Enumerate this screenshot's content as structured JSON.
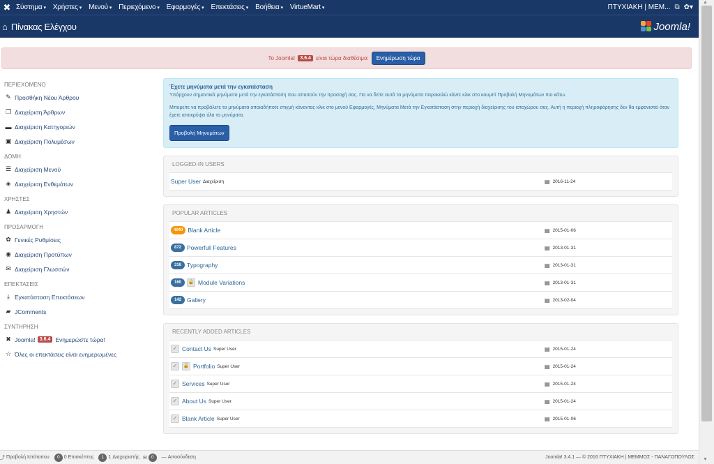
{
  "topbar": {
    "menu": [
      "Σύστημα",
      "Χρήστες",
      "Μενού",
      "Περιεχόμενο",
      "Εφαρμογές",
      "Επεκτάσεις",
      "Βοήθεια",
      "VirtueMart"
    ],
    "user": "ΠΤΥΧΙΑΚΗ | ΜΕΜ..."
  },
  "header": {
    "title": "Πίνακας Ελέγχου",
    "brand": "Joomla!"
  },
  "update_alert": {
    "prefix": "Το Joomla!",
    "version": "3.6.4",
    "suffix": "είναι τώρα διαθέσιμο:",
    "button": "Ενημέρωση τώρα"
  },
  "sidebar": {
    "sections": [
      {
        "title": "ΠΕΡΙΕΧΟΜΕΝΟ",
        "items": [
          {
            "label": "Προσθήκη Νέου Άρθρου",
            "icon": "pencil-icon",
            "glyph": "✎"
          },
          {
            "label": "Διαχείριση Άρθρων",
            "icon": "stack-icon",
            "glyph": "❐"
          },
          {
            "label": "Διαχείριση Κατηγοριών",
            "icon": "folder-icon",
            "glyph": "▬"
          },
          {
            "label": "Διαχείριση Πολυμέσων",
            "icon": "image-icon",
            "glyph": "▣"
          }
        ]
      },
      {
        "title": "ΔΟΜΗ",
        "items": [
          {
            "label": "Διαχείριση Μενού",
            "icon": "list-icon",
            "glyph": "☰"
          },
          {
            "label": "Διαχείριση Ενθεμάτων",
            "icon": "cube-icon",
            "glyph": "◈"
          }
        ]
      },
      {
        "title": "ΧΡΗΣΤΕΣ",
        "items": [
          {
            "label": "Διαχείριση Χρηστών",
            "icon": "users-icon",
            "glyph": "♟"
          }
        ]
      },
      {
        "title": "ΠΡΟΣΑΡΜΟΓΗ",
        "items": [
          {
            "label": "Γενικές Ρυθμίσεις",
            "icon": "gear-icon",
            "glyph": "✿"
          },
          {
            "label": "Διαχείριση Προτύπων",
            "icon": "eye-icon",
            "glyph": "◉"
          },
          {
            "label": "Διαχείριση Γλωσσών",
            "icon": "comments-icon",
            "glyph": "✉"
          }
        ]
      },
      {
        "title": "ΕΠΕΚΤΑΣΕΙΣ",
        "items": [
          {
            "label": "Εγκατάσταση Επεκτάσεων",
            "icon": "download-icon",
            "glyph": "⤓"
          },
          {
            "label": "JComments",
            "icon": "comment-icon",
            "glyph": "▰"
          }
        ]
      },
      {
        "title": "ΣΥΝΤΗΡΗΣΗ",
        "items": [
          {
            "label": "Joomla!",
            "badge": "3.6.4",
            "after": "Ενημερώστε τώρα!",
            "icon": "joomla-icon",
            "glyph": "✖"
          },
          {
            "label": "Όλες οι επεκτάσεις είναι ενημερωμένες",
            "icon": "star-icon",
            "glyph": "☆"
          }
        ]
      }
    ]
  },
  "postinstall": {
    "title": "Έχετε μηνύματα μετά την εγκατάσταση",
    "text1": "Υπάρχουν σημαντικά μηνύματα μετά την εγκατάσταση που απαιτούν την προσοχή σας. Για να δείτε αυτά τα μηνύματα παρακαλώ κάντε κλικ στο κουμπί Προβολή Μηνυμάτων πιο κάτω.",
    "text2": "Μπορείτε να προβάλετε τα μηνύματα οποιαδήποτε στιγμή κάνοντας κλικ στο μενού Εφαρμογές, Μηνύματα Μετά την Εγκατάσταση στην περιοχή διαχείρισης του ιστοχώρου σας. Αυτή η περιοχή πληροφόρησης δεν θα εμφανιστεί όταν έχετε αποκρύψει όλα τα μηνύματα.",
    "button": "Προβολή Μηνυμάτων"
  },
  "logged_in": {
    "title": "LOGGED-IN USERS",
    "rows": [
      {
        "name": "Super User",
        "role": "Διαχείριση",
        "date": "2016-11-24"
      }
    ]
  },
  "popular": {
    "title": "POPULAR ARTICLES",
    "rows": [
      {
        "hits": "4040",
        "title": "Blank Article",
        "date": "2015-01-06",
        "hot": true,
        "locked": false
      },
      {
        "hits": "872",
        "title": "Powerfull Features",
        "date": "2013-01-31",
        "hot": false,
        "locked": false
      },
      {
        "hits": "316",
        "title": "Typography",
        "date": "2013-01-31",
        "hot": false,
        "locked": false
      },
      {
        "hits": "160",
        "title": "Module Variations",
        "date": "2013-01-31",
        "hot": false,
        "locked": true
      },
      {
        "hits": "142",
        "title": "Gallery",
        "date": "2013-02-04",
        "hot": false,
        "locked": false
      }
    ]
  },
  "recent": {
    "title": "RECENTLY ADDED ARTICLES",
    "rows": [
      {
        "title": "Contact Us",
        "author": "Super User",
        "date": "2015-01-24",
        "locked": false
      },
      {
        "title": "Portfolio",
        "author": "Super User",
        "date": "2015-01-24",
        "locked": true
      },
      {
        "title": "Services",
        "author": "Super User",
        "date": "2015-01-24",
        "locked": false
      },
      {
        "title": "About Us",
        "author": "Super User",
        "date": "2015-01-24",
        "locked": false
      },
      {
        "title": "Blank Article",
        "author": "Super User",
        "date": "2015-01-06",
        "locked": false
      }
    ]
  },
  "footer": {
    "view_site": "Προβολή Ιστότοπου",
    "visitors_count": "0",
    "visitors": "Επισκέπτης",
    "admins_count": "1",
    "admins": "Διαχειριστής",
    "messages_count": "0",
    "logout": "Αποσύνδεση",
    "copyright": "Joomla! 3.4.1 — © 2016 ΠΤΥΧΙΑΚΗ | ΜΕΜΜΟΣ - ΠΑΝΑΓΟΠΟΥΛΟΣ"
  },
  "colors": {
    "navbar": "#1a3867",
    "alert_bg": "#f2dede",
    "info_bg": "#d9edf7",
    "link": "#2a6496",
    "hot_badge": "#f89406"
  }
}
